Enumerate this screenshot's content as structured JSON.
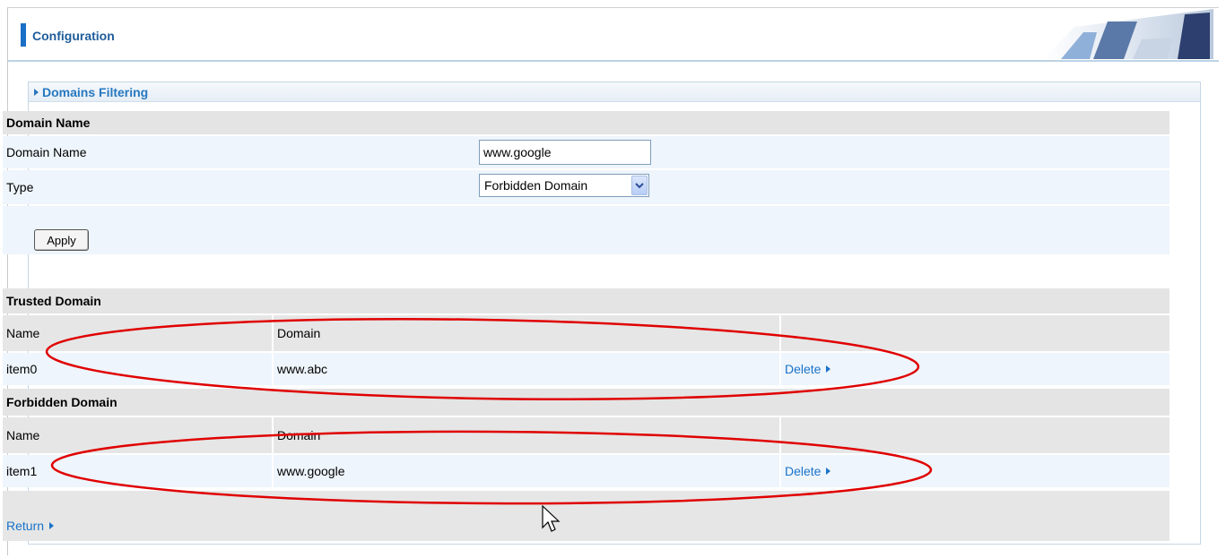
{
  "header": {
    "title": "Configuration"
  },
  "panel": {
    "title": "Domains Filtering"
  },
  "form": {
    "section_title": "Domain Name",
    "domain_label": "Domain Name",
    "domain_value": "www.google",
    "type_label": "Type",
    "type_selected": "Forbidden Domain",
    "apply_label": "Apply"
  },
  "trusted": {
    "title": "Trusted Domain",
    "columns": [
      "Name",
      "Domain",
      ""
    ],
    "rows": [
      {
        "name": "item0",
        "domain": "www.abc",
        "action": "Delete"
      }
    ]
  },
  "forbidden": {
    "title": "Forbidden Domain",
    "columns": [
      "Name",
      "Domain",
      ""
    ],
    "rows": [
      {
        "name": "item1",
        "domain": "www.google",
        "action": "Delete"
      }
    ]
  },
  "footer": {
    "return_label": "Return"
  },
  "colors": {
    "accent": "#1a6fc7",
    "link": "#1a73c9",
    "annotation": "#e00000"
  }
}
